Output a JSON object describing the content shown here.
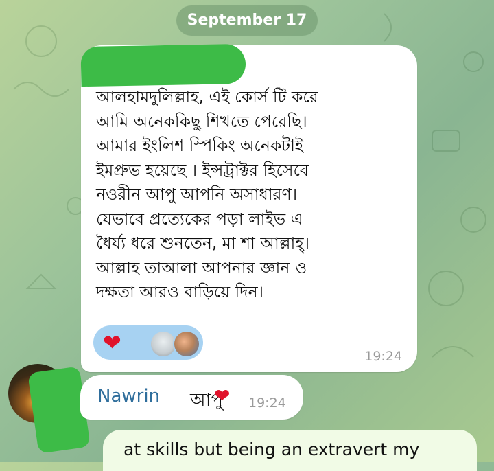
{
  "date_separator": "September 17",
  "messages": [
    {
      "text": "আলহামদুলিল্লাহ, এই কোর্স টি করে\nআমি অনেককিছু শিখতে পেরেছি।\nআমার ইংলিশ স্পিকিং অনেকটাই\nইমপ্রুভ হয়েছে । ইন্সট্রাক্টর হিসেবে\nনওরীন আপু আপনি অসাধারণ।\nযেভাবে প্রত্যেকের পড়া লাইভ এ\nধৈর্য্য ধরে শুনতেন, মা শা আল্লাহ্।\nআল্লাহ তাআলা আপনার জ্ঞান ও\nদক্ষতা আরও বাড়িয়ে দিন।",
      "time": "19:24",
      "reaction": "❤"
    },
    {
      "name": "Nawrin",
      "text": "আপু",
      "emoji": "❤",
      "time": "19:24"
    },
    {
      "text": "at skills but being an extravert my"
    }
  ],
  "colors": {
    "redaction": "#3dbb47",
    "reaction_bg": "#a7d2f2",
    "name_link": "#2f6e9c"
  },
  "icons": [
    "heart-icon",
    "reactor-avatar",
    "sender-avatar"
  ]
}
